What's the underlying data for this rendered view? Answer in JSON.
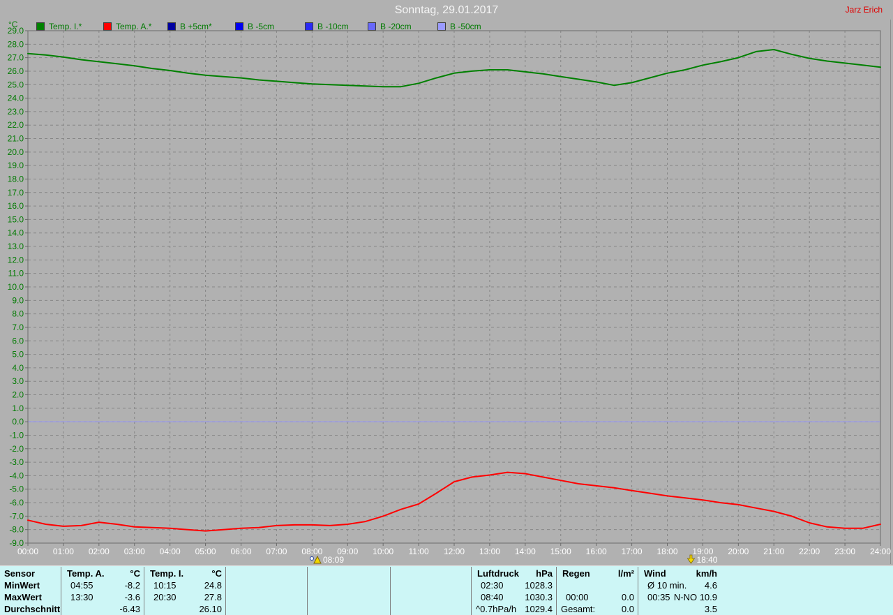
{
  "header": {
    "title": "Sonntag, 29.01.2017",
    "author": "Jarz Erich"
  },
  "legend": {
    "unit": "°C",
    "items": [
      {
        "label": "Temp. I.*",
        "color": "#008000"
      },
      {
        "label": "Temp. A.*",
        "color": "#ff0000"
      },
      {
        "label": "B +5cm*",
        "color": "#0000a0"
      },
      {
        "label": "B -5cm",
        "color": "#0000f0"
      },
      {
        "label": "B -10cm",
        "color": "#2a2af5"
      },
      {
        "label": "B -20cm",
        "color": "#6868fa"
      },
      {
        "label": "B -50cm",
        "color": "#9a9aff"
      }
    ]
  },
  "chart_data": {
    "type": "line",
    "title": "Sonntag, 29.01.2017",
    "ylabel": "°C",
    "xlim": [
      0,
      24
    ],
    "ylim": [
      -9,
      29
    ],
    "ytick_step": 1,
    "grid": true,
    "xticks": [
      "00:00",
      "01:00",
      "02:00",
      "03:00",
      "04:00",
      "05:00",
      "06:00",
      "07:00",
      "08:00",
      "09:00",
      "10:00",
      "11:00",
      "12:00",
      "13:00",
      "14:00",
      "15:00",
      "16:00",
      "17:00",
      "18:00",
      "19:00",
      "20:00",
      "21:00",
      "22:00",
      "23:00",
      "24:00"
    ],
    "x_start": 0,
    "x_step": 0.5,
    "series": [
      {
        "name": "Temp. I.",
        "color": "#008000",
        "values": [
          27.3,
          27.2,
          27.05,
          26.85,
          26.7,
          26.55,
          26.4,
          26.2,
          26.05,
          25.85,
          25.7,
          25.6,
          25.5,
          25.35,
          25.25,
          25.15,
          25.05,
          25.0,
          24.95,
          24.9,
          24.85,
          24.85,
          25.1,
          25.5,
          25.85,
          26.0,
          26.1,
          26.1,
          25.95,
          25.8,
          25.6,
          25.4,
          25.2,
          24.95,
          25.15,
          25.5,
          25.85,
          26.1,
          26.45,
          26.7,
          27.0,
          27.45,
          27.6,
          27.25,
          26.95,
          26.75,
          26.6,
          26.45,
          26.3
        ]
      },
      {
        "name": "Temp. A.",
        "color": "#ff0000",
        "values": [
          -7.3,
          -7.6,
          -7.75,
          -7.7,
          -7.45,
          -7.6,
          -7.8,
          -7.85,
          -7.9,
          -8.0,
          -8.1,
          -8.0,
          -7.9,
          -7.85,
          -7.7,
          -7.65,
          -7.65,
          -7.7,
          -7.6,
          -7.4,
          -7.0,
          -6.5,
          -6.1,
          -5.3,
          -4.45,
          -4.1,
          -3.95,
          -3.75,
          -3.85,
          -4.1,
          -4.35,
          -4.6,
          -4.75,
          -4.9,
          -5.1,
          -5.3,
          -5.5,
          -5.65,
          -5.8,
          -6.0,
          -6.15,
          -6.4,
          -6.65,
          -7.0,
          -7.5,
          -7.8,
          -7.9,
          -7.9,
          -7.6
        ]
      }
    ],
    "zero_line": {
      "value": 0.0,
      "color": "#9595ff"
    },
    "markers": [
      {
        "type": "sunrise",
        "time": "08:09",
        "hour": 8.15
      },
      {
        "type": "sunset",
        "time": "18:40",
        "hour": 18.667
      }
    ]
  },
  "stats_table": {
    "row_labels": [
      "Sensor",
      "MinWert",
      "MaxWert",
      "Durchschnitt"
    ],
    "columns": [
      {
        "name": "Temp. A.",
        "unit": "°C",
        "rows": [
          [
            "04:55",
            "-8.2"
          ],
          [
            "13:30",
            "-3.6"
          ],
          [
            "",
            "-6.43"
          ]
        ]
      },
      {
        "name": "Temp. I.",
        "unit": "°C",
        "rows": [
          [
            "10:15",
            "24.8"
          ],
          [
            "20:30",
            "27.8"
          ],
          [
            "",
            "26.10"
          ]
        ]
      },
      {
        "name": "",
        "unit": "",
        "rows": [
          [
            "",
            ""
          ],
          [
            "",
            ""
          ],
          [
            "",
            ""
          ]
        ]
      },
      {
        "name": "",
        "unit": "",
        "rows": [
          [
            "",
            ""
          ],
          [
            "",
            ""
          ],
          [
            "",
            ""
          ]
        ]
      },
      {
        "name": "",
        "unit": "",
        "rows": [
          [
            "",
            ""
          ],
          [
            "",
            ""
          ],
          [
            "",
            ""
          ]
        ]
      },
      {
        "name": "Luftdruck",
        "unit": "hPa",
        "rows": [
          [
            "02:30",
            "1028.3"
          ],
          [
            "08:40",
            "1030.3"
          ],
          [
            "^0.7hPa/h",
            "1029.4"
          ]
        ]
      },
      {
        "name": "Regen",
        "unit": "l/m²",
        "rows": [
          [
            "",
            ""
          ],
          [
            "00:00",
            "0.0"
          ],
          [
            "Gesamt:",
            "0.0"
          ]
        ]
      },
      {
        "name": "Wind",
        "unit": "km/h",
        "rows": [
          [
            "Ø 10 min.",
            "4.6"
          ],
          [
            "00:35",
            "N-NO 10.9"
          ],
          [
            "",
            "3.5"
          ]
        ]
      }
    ]
  },
  "colors": {
    "background": "#b1b1b1",
    "grid": "#868686",
    "plot_border": "#6a6a6a",
    "y_labels": "#007a00",
    "x_labels": "#ffffff",
    "panel_background": "#cdf6f6",
    "panel_divider": "#808080",
    "author": "#e00000",
    "marker_sun": "#f2d800"
  }
}
